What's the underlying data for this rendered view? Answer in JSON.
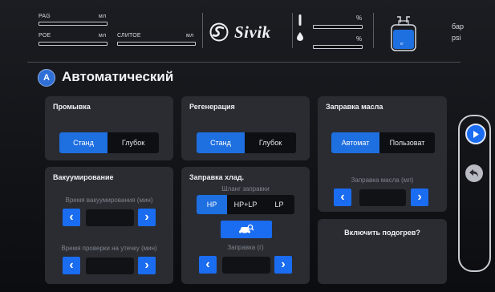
{
  "header": {
    "pag_label": "PAG",
    "pag_unit": "мл",
    "poe_label": "POE",
    "poe_unit": "мл",
    "drain_label": "СЛИТОЕ",
    "drain_unit": "мл",
    "brand": "Sivik",
    "pct1": "%",
    "pct2": "%",
    "bottle_label": "кг",
    "unit_bar": "бар",
    "unit_psi": "psi"
  },
  "title": {
    "text": "Автоматический",
    "icon_letter": "A"
  },
  "panels": {
    "flush": {
      "title": "Промывка",
      "options": [
        "Станд",
        "Глубок"
      ],
      "selected": "Станд"
    },
    "regen": {
      "title": "Регенерация",
      "options": [
        "Станд",
        "Глубок"
      ],
      "selected": "Станд"
    },
    "oil": {
      "title": "Заправка масла",
      "options": [
        "Автомат",
        "Пользоват"
      ],
      "selected": "Автомат",
      "caption": "Заправка масла (мл)"
    },
    "vacuum": {
      "title": "Вакуумирование",
      "time_caption": "Время вакуумирования (мин)",
      "leak_caption": "Время проверки на утечку (мин)"
    },
    "refrigerant": {
      "title": "Заправка хлад.",
      "hose_caption": "Шланг заправки",
      "hose_options": [
        "HP",
        "HP+LP",
        "LP"
      ],
      "hose_selected": "HP",
      "amount_caption": "Заправка (г)"
    },
    "heater": {
      "title": "Включить подогрев?"
    }
  },
  "nav": {
    "next_icon": "play-icon",
    "back_icon": "back-arrow-icon"
  },
  "colors": {
    "accent": "#1e6fe0",
    "panel": "#2a2c32",
    "background": "#15161a"
  }
}
